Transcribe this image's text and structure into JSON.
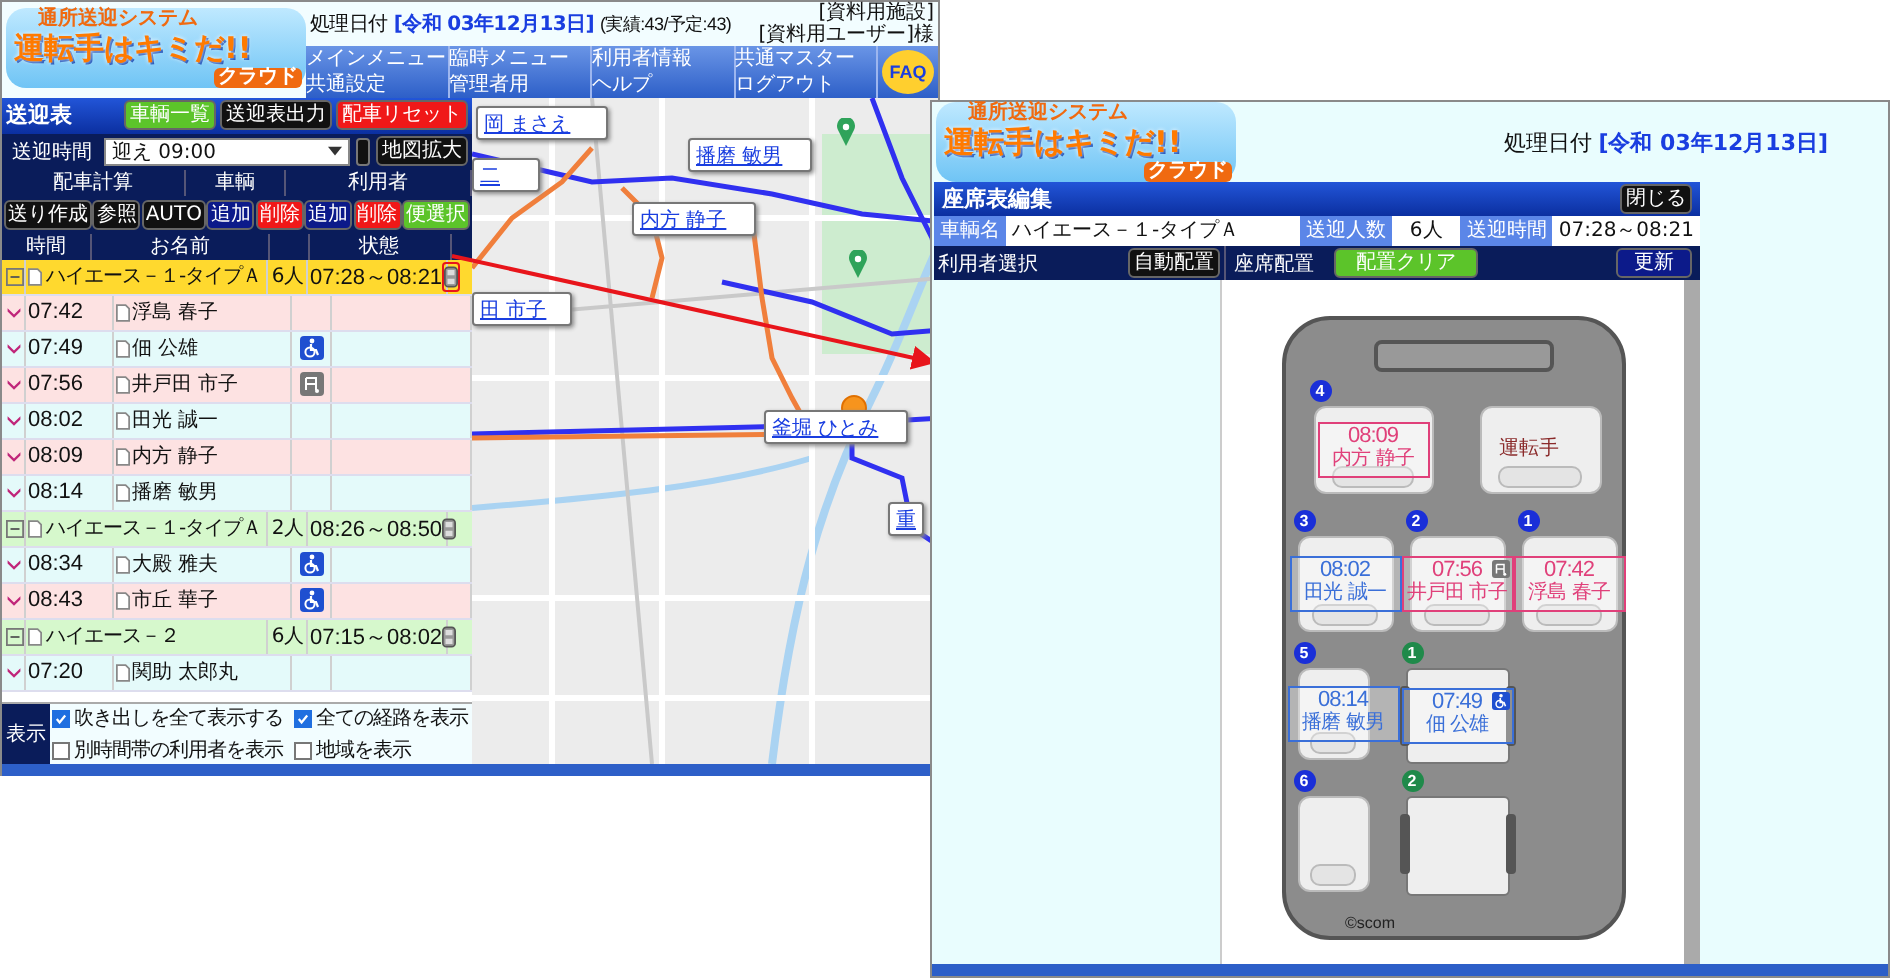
{
  "main_window": {
    "logo": {
      "tagline": "通所送迎システム",
      "title": "運転手はキミだ!!",
      "sub": "クラウド"
    },
    "date_label": "処理日付",
    "date": "[令和 03年12月13日]",
    "counts": "(実績:43/予定:43)",
    "account": [
      "[資料用施設]",
      "[資料用ユーザー]様"
    ],
    "menu": [
      "メインメニュー",
      "臨時メニュー",
      "利用者情報",
      "共通マスター",
      "共通設定",
      "管理者用",
      "ヘルプ",
      "ログアウト"
    ],
    "faq": "FAQ",
    "panel": {
      "title": "送迎表",
      "title_buttons": [
        {
          "label": "車輌一覧",
          "kind": "ok"
        },
        {
          "label": "送迎表出力",
          "kind": "dark"
        },
        {
          "label": "配車リセット",
          "kind": "danger"
        }
      ],
      "time_label": "送迎時間",
      "time_value": "迎え 09:00",
      "map_button": "地図拡大",
      "sections": [
        "配車計算",
        "車輌",
        "利用者"
      ],
      "action_buttons": [
        {
          "label": "送り作成",
          "kind": "dark"
        },
        {
          "label": "参照",
          "kind": "dark"
        },
        {
          "label": "AUTO",
          "kind": "dark"
        },
        {
          "label": "追加",
          "kind": "primary"
        },
        {
          "label": "削除",
          "kind": "danger"
        },
        {
          "label": "追加",
          "kind": "primary"
        },
        {
          "label": "削除",
          "kind": "danger"
        },
        {
          "label": "便選択",
          "kind": "ok"
        }
      ],
      "columns": {
        "time": "時間",
        "name": "お名前",
        "status": "状態"
      },
      "rows": [
        {
          "kind": "group",
          "selected": true,
          "name": "ハイエース－１-タイプＡ",
          "count": "6人",
          "time": "07:28～08:21"
        },
        {
          "kind": "user",
          "time": "07:42",
          "name": "浮島 春子",
          "color": "#fde2e2"
        },
        {
          "kind": "user",
          "time": "07:49",
          "name": "佃 公雄",
          "color": "#e4fafa",
          "wheelchair": true
        },
        {
          "kind": "user",
          "time": "07:56",
          "name": "井戸田 市子",
          "color": "#fde2e2",
          "walker": true
        },
        {
          "kind": "user",
          "time": "08:02",
          "name": "田光 誠一",
          "color": "#e4fafa"
        },
        {
          "kind": "user",
          "time": "08:09",
          "name": "内方 静子",
          "color": "#fde2e2"
        },
        {
          "kind": "user",
          "time": "08:14",
          "name": "播磨 敏男",
          "color": "#e4fafa"
        },
        {
          "kind": "group",
          "selected": false,
          "name": "ハイエース－１-タイプＡ",
          "count": "2人",
          "time": "08:26～08:50"
        },
        {
          "kind": "user",
          "time": "08:34",
          "name": "大殿 雅夫",
          "color": "#e4fafa",
          "wheelchair": true
        },
        {
          "kind": "user",
          "time": "08:43",
          "name": "市丘 華子",
          "color": "#fde2e2",
          "wheelchair": true
        },
        {
          "kind": "group",
          "selected": false,
          "name": "ハイエース－２",
          "count": "6人",
          "time": "07:15～08:02"
        },
        {
          "kind": "user",
          "time": "07:20",
          "name": "関助 太郎丸",
          "color": "#e4fafa"
        }
      ],
      "display": {
        "label": "表示",
        "options": [
          {
            "label": "吹き出しを全て表示する",
            "checked": true
          },
          {
            "label": "全ての経路を表示",
            "checked": true
          },
          {
            "label": "別時間帯の利用者を表示",
            "checked": false
          },
          {
            "label": "地域を表示",
            "checked": false
          }
        ]
      }
    },
    "map": {
      "callouts": [
        "岡 まさえ",
        "二",
        "播磨 敏男",
        "内方 静子",
        "田 市子",
        "釜堀 ひとみ",
        "重"
      ]
    }
  },
  "seat_window": {
    "logo": {
      "tagline": "通所送迎システム",
      "title": "運転手はキミだ!!",
      "sub": "クラウド"
    },
    "date_label": "処理日付",
    "date": "[令和 03年12月13日]",
    "title": "座席表編集",
    "close": "閉じる",
    "info": [
      {
        "label": "車輌名",
        "value": "ハイエース－１-タイプＡ"
      },
      {
        "label": "送迎人数",
        "value": "6人"
      },
      {
        "label": "送迎時間",
        "value": "07:28～08:21"
      }
    ],
    "user_select_label": "利用者選択",
    "auto_button": "自動配置",
    "seat_label": "座席配置",
    "clear_button": "配置クリア",
    "update_button": "更新",
    "seats": [
      {
        "kind": "seat",
        "number": "4",
        "time": "08:09",
        "name": "内方 静子",
        "color": "#e0407a"
      },
      {
        "kind": "driver",
        "label": "運転手"
      },
      {
        "kind": "seat",
        "number": "3",
        "time": "08:02",
        "name": "田光 誠一",
        "color": "#3a6fd8"
      },
      {
        "kind": "seat",
        "number": "2",
        "time": "07:56",
        "name": "井戸田 市子",
        "color": "#e0407a",
        "walker": true
      },
      {
        "kind": "seat",
        "number": "1",
        "time": "07:42",
        "name": "浮島 春子",
        "color": "#e0407a"
      },
      {
        "kind": "seat",
        "number": "5",
        "time": "08:14",
        "name": "播磨 敏男",
        "color": "#3a6fd8"
      },
      {
        "kind": "wheelchair",
        "number": "1",
        "time": "07:49",
        "name": "佃 公雄",
        "color": "#3a6fd8",
        "wheelchair": true
      },
      {
        "kind": "seat",
        "number": "6"
      },
      {
        "kind": "wheelchair",
        "number": "2"
      }
    ],
    "credit": "©scom"
  }
}
